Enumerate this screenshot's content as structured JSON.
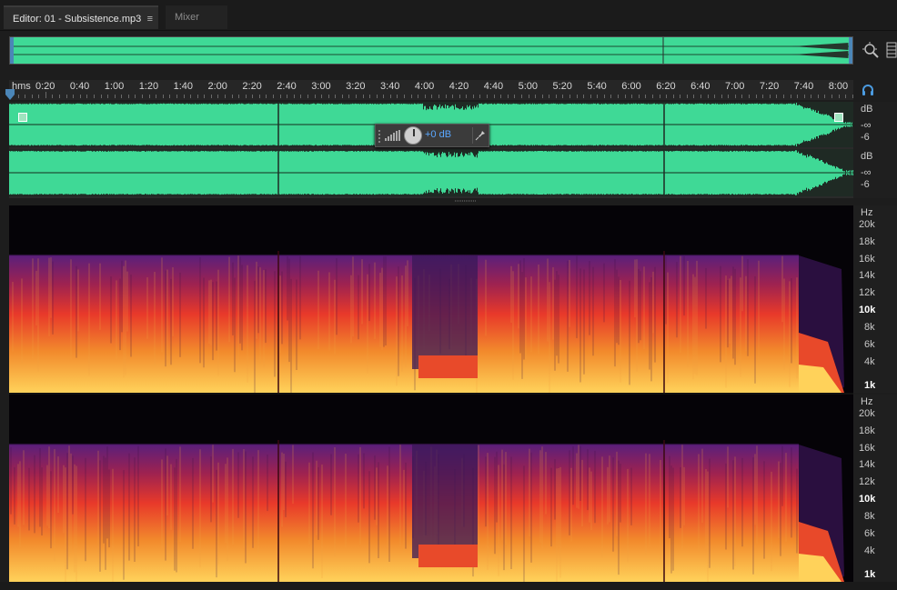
{
  "tabs": {
    "editor_label": "Editor: 01 - Subsistence.mp3",
    "editor_menu": "≡",
    "mixer_label": "Mixer"
  },
  "ruler": {
    "unit_label": "hms",
    "labels": [
      "0:20",
      "0:40",
      "1:00",
      "1:20",
      "1:40",
      "2:00",
      "2:20",
      "2:40",
      "3:00",
      "3:20",
      "3:40",
      "4:00",
      "4:20",
      "4:40",
      "5:00",
      "5:20",
      "5:40",
      "6:00",
      "6:20",
      "6:40",
      "7:00",
      "7:20",
      "7:40",
      "8:00"
    ]
  },
  "hud": {
    "value": "+0 dB"
  },
  "amplitude_scale": {
    "channel1": [
      "dB",
      "-∞",
      "-6"
    ],
    "channel2": [
      "dB",
      "-∞",
      "-6"
    ]
  },
  "frequency_scale": {
    "unit": "Hz",
    "labels": [
      "20k",
      "18k",
      "16k",
      "14k",
      "12k",
      "10k",
      "8k",
      "6k",
      "4k",
      "1k"
    ],
    "emphasized": [
      "10k",
      "1k"
    ]
  },
  "colors": {
    "waveform": "#3fd996",
    "waveform_dark": "#1f2a24",
    "spectral_low": "#ffd25a",
    "spectral_mid": "#e8392a",
    "spectral_high": "#5c1f7a",
    "spectral_bg": "#050307",
    "accent": "#4b86b8",
    "hud_value": "#5aa7ff"
  },
  "icons": {
    "zoom": "zoom-icon",
    "panel": "panel-icon",
    "headphones": "headphones-icon",
    "pin": "pin-icon",
    "meter": "meter-icon",
    "knob": "volume-knob-icon"
  }
}
